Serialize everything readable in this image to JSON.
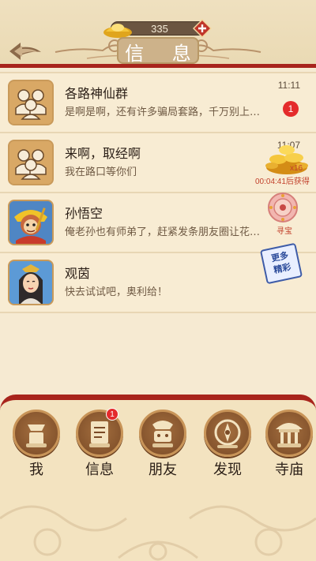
{
  "header": {
    "title": "信 息",
    "currency_value": "335"
  },
  "messages": [
    {
      "name": "各路神仙群",
      "preview": "是啊是啊，还有许多骗局套路，千万别上…",
      "time": "11:11",
      "unread": "1",
      "avatar": "group-avatar"
    },
    {
      "name": "来啊，取经啊",
      "preview": "我在路口等你们",
      "time": "11:07",
      "avatar": "group-avatar"
    },
    {
      "name": "孙悟空",
      "preview": "俺老孙也有师弟了，赶紧发条朋友圈让花…",
      "avatar": "sun-wukong-avatar"
    },
    {
      "name": "观茵",
      "preview": "快去试试吧，奥利给！",
      "avatar": "guanyin-avatar"
    }
  ],
  "widgets": {
    "treasure_count": "x16",
    "treasure_timer": "00:04:41后获得",
    "wheel_label": "寻宝",
    "more_line1": "更多",
    "more_line2": "精彩"
  },
  "nav": {
    "items": [
      {
        "label": "我",
        "icon": "me-icon"
      },
      {
        "label": "信息",
        "icon": "message-icon",
        "badge": "1"
      },
      {
        "label": "朋友",
        "icon": "friends-icon"
      },
      {
        "label": "发现",
        "icon": "compass-icon"
      },
      {
        "label": "寺庙",
        "icon": "temple-icon"
      }
    ]
  },
  "colors": {
    "accent_red": "#a8241c",
    "background": "#f6ead2",
    "badge_red": "#e42b2b"
  }
}
